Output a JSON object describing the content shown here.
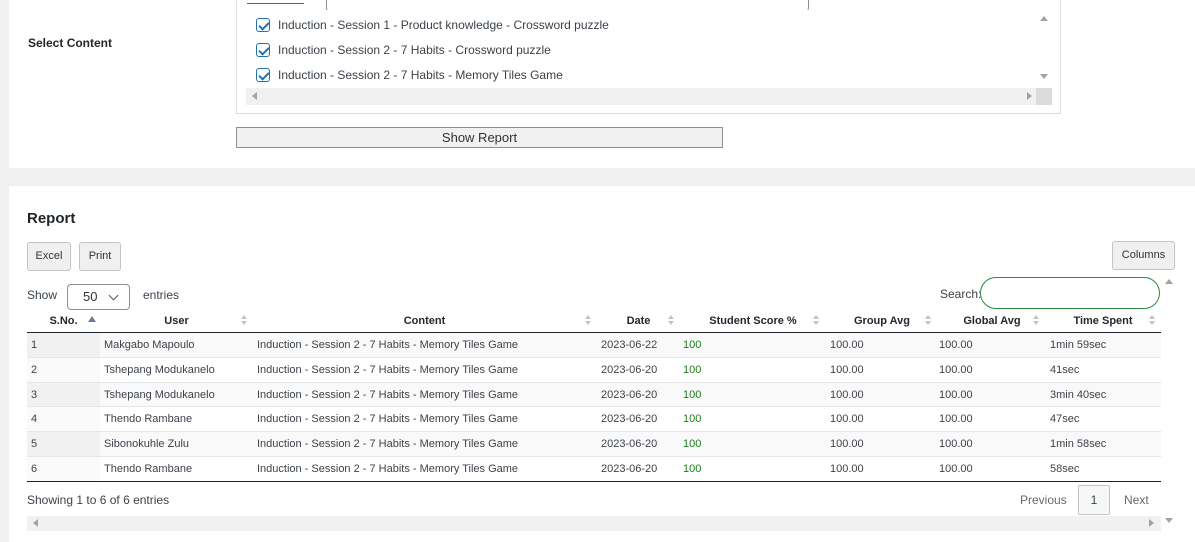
{
  "content_selector": {
    "label": "Select Content",
    "options": [
      {
        "label": "Induction - Session 1 - Product knowledge - Crossword puzzle",
        "checked": true
      },
      {
        "label": "Induction - Session 2 - 7 Habits - Crossword puzzle",
        "checked": true
      },
      {
        "label": "Induction - Session 2 - 7 Habits - Memory Tiles Game",
        "checked": true
      }
    ],
    "show_report_label": "Show Report"
  },
  "report": {
    "title": "Report",
    "buttons": {
      "excel": "Excel",
      "print": "Print",
      "columns": "Columns"
    },
    "length": {
      "show_label": "Show",
      "value": "50",
      "entries_label": "entries"
    },
    "search": {
      "label": "Search:",
      "value": ""
    },
    "columns": [
      "S.No.",
      "User",
      "Content",
      "Date",
      "Student Score %",
      "Group Avg",
      "Global Avg",
      "Time Spent"
    ],
    "sorted_column": "S.No.",
    "sort_direction": "ascending",
    "rows": [
      {
        "sno": "1",
        "user": "Makgabo Mapoulo",
        "content": "Induction - Session 2 - 7 Habits - Memory Tiles Game",
        "date": "2023-06-22",
        "score": "100",
        "group_avg": "100.00",
        "global_avg": "100.00",
        "time": "1min 59sec"
      },
      {
        "sno": "2",
        "user": "Tshepang Modukanelo",
        "content": "Induction - Session 2 - 7 Habits - Memory Tiles Game",
        "date": "2023-06-20",
        "score": "100",
        "group_avg": "100.00",
        "global_avg": "100.00",
        "time": "41sec"
      },
      {
        "sno": "3",
        "user": "Tshepang Modukanelo",
        "content": "Induction - Session 2 - 7 Habits - Memory Tiles Game",
        "date": "2023-06-20",
        "score": "100",
        "group_avg": "100.00",
        "global_avg": "100.00",
        "time": "3min 40sec"
      },
      {
        "sno": "4",
        "user": "Thendo Rambane",
        "content": "Induction - Session 2 - 7 Habits - Memory Tiles Game",
        "date": "2023-06-20",
        "score": "100",
        "group_avg": "100.00",
        "global_avg": "100.00",
        "time": "47sec"
      },
      {
        "sno": "5",
        "user": "Sibonokuhle Zulu",
        "content": "Induction - Session 2 - 7 Habits - Memory Tiles Game",
        "date": "2023-06-20",
        "score": "100",
        "group_avg": "100.00",
        "global_avg": "100.00",
        "time": "1min 58sec"
      },
      {
        "sno": "6",
        "user": "Thendo Rambane",
        "content": "Induction - Session 2 - 7 Habits - Memory Tiles Game",
        "date": "2023-06-20",
        "score": "100",
        "group_avg": "100.00",
        "global_avg": "100.00",
        "time": "58sec"
      }
    ],
    "info": "Showing 1 to 6 of 6 entries",
    "pagination": {
      "previous": "Previous",
      "current": "1",
      "next": "Next"
    }
  },
  "colors": {
    "accent": "#2271b1",
    "score": "#1e7c1e",
    "search_border": "#2a8a3f"
  }
}
